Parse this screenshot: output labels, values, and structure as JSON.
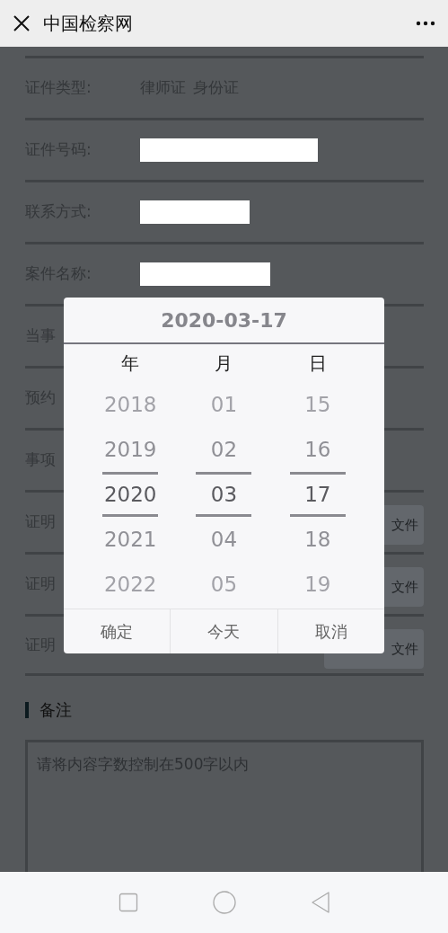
{
  "header": {
    "title": "中国检察网"
  },
  "form": {
    "rows": [
      {
        "kind": "options",
        "label": "证件类型:",
        "options": [
          "律师证",
          "身份证"
        ]
      },
      {
        "kind": "field",
        "label": "证件号码:"
      },
      {
        "kind": "field",
        "label": "联系方式:"
      },
      {
        "kind": "field",
        "label": "案件名称:"
      },
      {
        "kind": "plain",
        "label": "当事"
      },
      {
        "kind": "plain",
        "label": "预约"
      },
      {
        "kind": "plain",
        "label": "事项"
      },
      {
        "kind": "upload",
        "label": "证明",
        "button": "文件"
      },
      {
        "kind": "upload",
        "label": "证明",
        "button": "文件"
      },
      {
        "kind": "upload",
        "label": "证明",
        "button": "文件"
      }
    ]
  },
  "remarks": {
    "heading": "备注",
    "placeholder": "请将内容字数控制在500字以内"
  },
  "date_picker": {
    "title": "2020-03-17",
    "columns": [
      {
        "header": "年",
        "items": [
          {
            "text": "2018",
            "selected": false
          },
          {
            "text": "2019",
            "selected": false
          },
          {
            "text": "2020",
            "selected": true
          },
          {
            "text": "2021",
            "selected": false
          },
          {
            "text": "2022",
            "selected": false
          }
        ]
      },
      {
        "header": "月",
        "items": [
          {
            "text": "01",
            "selected": false
          },
          {
            "text": "02",
            "selected": false
          },
          {
            "text": "03",
            "selected": true
          },
          {
            "text": "04",
            "selected": false
          },
          {
            "text": "05",
            "selected": false
          }
        ]
      },
      {
        "header": "日",
        "items": [
          {
            "text": "15",
            "selected": false
          },
          {
            "text": "16",
            "selected": false
          },
          {
            "text": "17",
            "selected": true
          },
          {
            "text": "18",
            "selected": false
          },
          {
            "text": "19",
            "selected": false
          }
        ]
      }
    ],
    "buttons": [
      "确定",
      "今天",
      "取消"
    ]
  }
}
